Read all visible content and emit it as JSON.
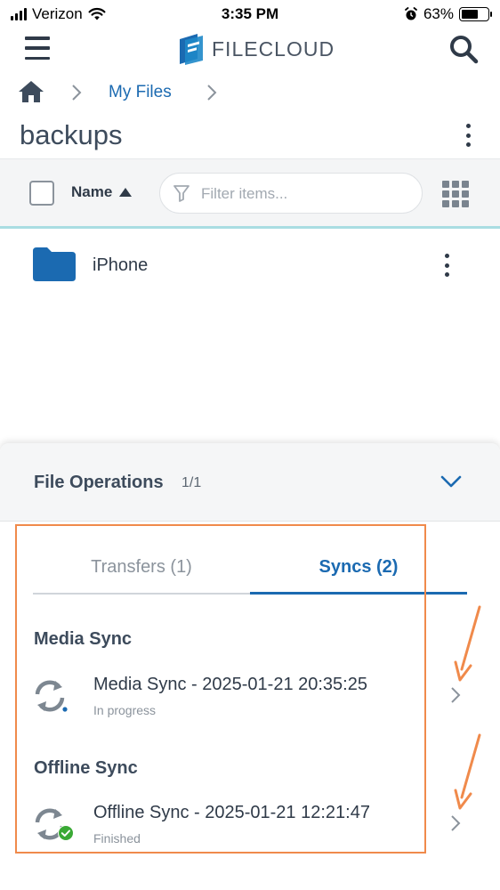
{
  "status_bar": {
    "carrier": "Verizon",
    "time": "3:35 PM",
    "battery": "63%",
    "battery_level": 0.63
  },
  "header": {
    "logo_text": "FILECLOUD",
    "menu_icon": "hamburger-menu-icon",
    "search_icon": "search-icon"
  },
  "breadcrumb": {
    "home_icon": "home-icon",
    "items": [
      {
        "label": "My Files"
      }
    ]
  },
  "folder": {
    "title": "backups"
  },
  "toolbar": {
    "sort_label": "Name",
    "filter_placeholder": "Filter items..."
  },
  "files": [
    {
      "name": "iPhone",
      "type": "folder"
    }
  ],
  "file_operations": {
    "title": "File Operations",
    "count": "1/1",
    "tabs": [
      {
        "label": "Transfers (1)",
        "active": false
      },
      {
        "label": "Syncs (2)",
        "active": true
      }
    ],
    "syncs": [
      {
        "heading": "Media Sync",
        "title": "Media Sync - 2025-01-21 20:35:25",
        "status": "In progress"
      },
      {
        "heading": "Offline Sync",
        "title": "Offline Sync - 2025-01-21 12:21:47",
        "status": "Finished"
      }
    ]
  },
  "colors": {
    "accent": "#1b6ab1",
    "text_dark": "#2f3a48",
    "folder_blue": "#1b6ab1",
    "highlight_orange": "#f08a4b",
    "success_green": "#3aa935",
    "toolbar_underline": "#a9dde2"
  }
}
